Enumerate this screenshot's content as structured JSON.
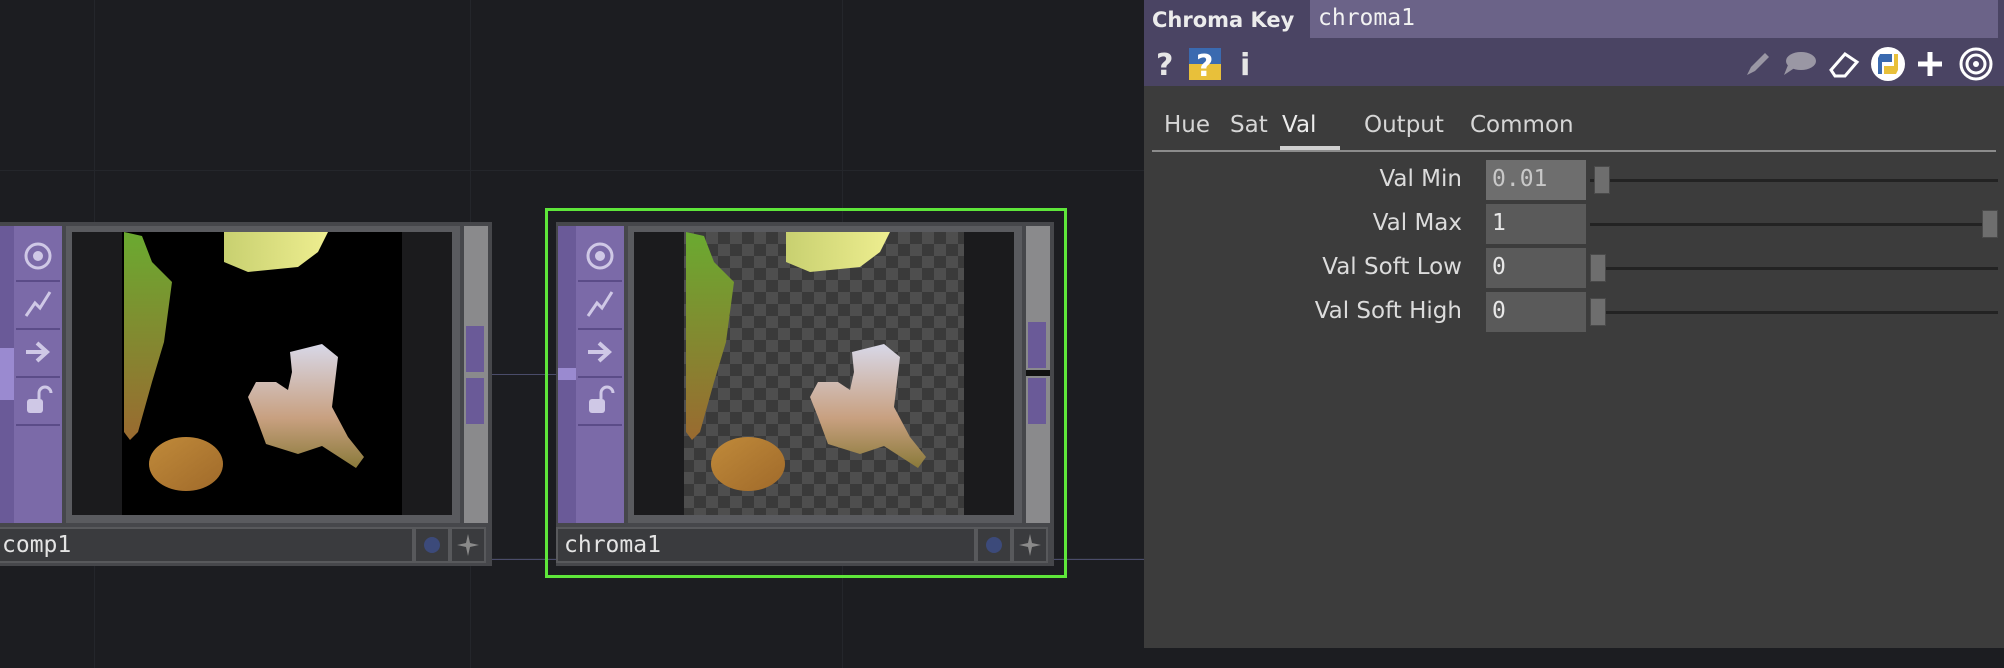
{
  "network": {
    "nodes": [
      {
        "name": "comp1"
      },
      {
        "name": "chroma1"
      }
    ]
  },
  "panel": {
    "op_type": "Chroma Key",
    "op_name": "chroma1",
    "toolbar": {
      "help_icon": "question-icon",
      "python_help_icon": "python-question-icon",
      "info_icon": "info-icon",
      "edit_icon": "pencil-icon",
      "comment_icon": "speech-bubble-icon",
      "clone_icon": "eraser-icon",
      "python_icon": "python-icon",
      "add_icon": "plus-icon",
      "target_icon": "target-icon"
    },
    "tabs": [
      "Hue",
      "Sat",
      "Val",
      "Output",
      "Common"
    ],
    "active_tab": "Val",
    "params": [
      {
        "label": "Val Min",
        "value": "0.01",
        "slider": 0.01
      },
      {
        "label": "Val Max",
        "value": "1",
        "slider": 1.0
      },
      {
        "label": "Val Soft Low",
        "value": "0",
        "slider": 0.0
      },
      {
        "label": "Val Soft High",
        "value": "0",
        "slider": 0.0
      }
    ]
  },
  "colors": {
    "selected_border": "#5ee63a",
    "panel_header": "#4a4463",
    "node_purple": "#7b6aa8"
  }
}
